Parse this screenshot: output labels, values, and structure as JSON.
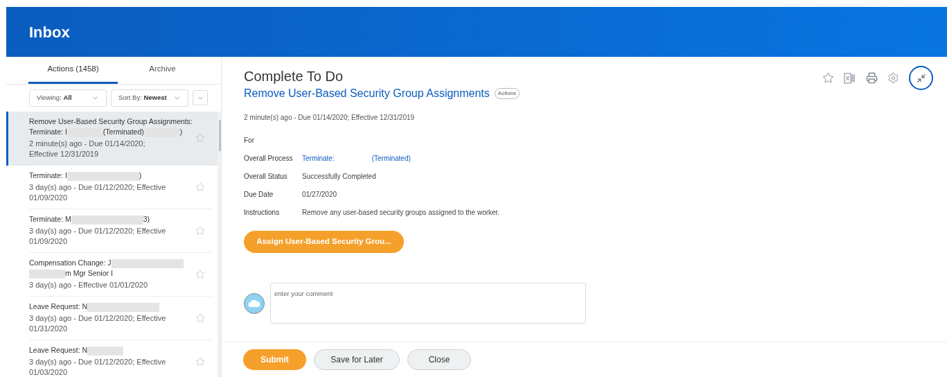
{
  "header": {
    "title": "Inbox"
  },
  "tabs": [
    {
      "label": "Actions (1458)",
      "selected": true
    },
    {
      "label": "Archive",
      "selected": false
    }
  ],
  "filters": [
    {
      "label": "Viewing:",
      "value": "All"
    },
    {
      "label": "Sort By:",
      "value": "Newest"
    }
  ],
  "items": [
    {
      "selected": true,
      "title": [
        {
          "kind": "line",
          "text": "Remove User-Based Security Group Assignments:"
        },
        {
          "kind": "text",
          "text": "Terminate: I"
        },
        {
          "kind": "redacted"
        },
        {
          "kind": "text",
          "text": "(Terminated)"
        },
        {
          "kind": "redacted"
        },
        {
          "kind": "text",
          "text": ")"
        }
      ],
      "meta": "2 minute(s) ago - Due 01/14/2020; Effective 12/31/2019"
    },
    {
      "selected": false,
      "title": [
        {
          "kind": "text",
          "text": "Terminate: I"
        },
        {
          "kind": "redacted"
        },
        {
          "kind": "redacted"
        },
        {
          "kind": "text",
          "text": ")"
        }
      ],
      "meta": "3 day(s) ago - Due 01/12/2020; Effective 01/09/2020"
    },
    {
      "selected": false,
      "title": [
        {
          "kind": "text",
          "text": "Terminate: M"
        },
        {
          "kind": "redacted"
        },
        {
          "kind": "redacted"
        },
        {
          "kind": "text",
          "text": "3)"
        }
      ],
      "meta": "3 day(s) ago - Due 01/12/2020; Effective 01/09/2020"
    },
    {
      "selected": false,
      "title": [
        {
          "kind": "text",
          "text": "Compensation Change: J"
        },
        {
          "kind": "redacted"
        },
        {
          "kind": "redacted"
        },
        {
          "kind": "redacted"
        },
        {
          "kind": "text",
          "text": "m Mgr Senior I"
        }
      ],
      "meta": "3 day(s) ago - Effective 01/01/2020"
    },
    {
      "selected": false,
      "title": [
        {
          "kind": "text",
          "text": "Leave Request: N"
        },
        {
          "kind": "redacted"
        },
        {
          "kind": "redacted"
        }
      ],
      "meta": "3 day(s) ago - Due 01/12/2020; Effective 01/31/2020"
    },
    {
      "selected": false,
      "title": [
        {
          "kind": "text",
          "text": "Leave Request: N"
        },
        {
          "kind": "redacted"
        }
      ],
      "meta": "3 day(s) ago - Due 01/12/2020; Effective 01/03/2020"
    }
  ],
  "detail": {
    "heading": "Complete To Do",
    "task": "Remove User-Based Security Group Assignments",
    "task_badge": "Actions",
    "meta": "2 minute(s) ago - Due 01/14/2020; Effective 12/31/2019",
    "fields": [
      {
        "label": "For",
        "kind": "empty"
      },
      {
        "label": "Overall Process",
        "kind": "link",
        "values": [
          "Terminate:",
          "(Terminated)"
        ]
      },
      {
        "label": "Overall Status",
        "kind": "text",
        "values": [
          "Successfully Completed"
        ]
      },
      {
        "label": "Due Date",
        "kind": "text",
        "values": [
          "01/27/2020"
        ]
      },
      {
        "label": "Instructions",
        "kind": "text",
        "values": [
          "Remove any user-based security groups assigned to the worker."
        ]
      }
    ],
    "action_button": "Assign User-Based Security Grou...",
    "comment": {
      "placeholder": "enter your comment"
    }
  },
  "footer_buttons": [
    {
      "label": "Submit",
      "kind": "primary"
    },
    {
      "label": "Save for Later",
      "kind": "secondary"
    },
    {
      "label": "Close",
      "kind": "secondary"
    }
  ]
}
